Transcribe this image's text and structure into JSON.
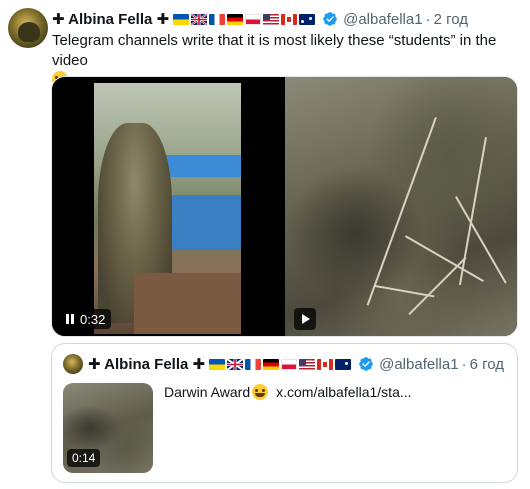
{
  "tweet": {
    "author_name": "✚ Albina Fella ✚",
    "handle": "@albafella1",
    "time": "2 год",
    "text": "Telegram channels write that it is most likely these “students” in the video",
    "emoji_icon": "grinning-face-emoji",
    "flags": [
      "ua",
      "gb",
      "fr",
      "de",
      "pl",
      "us",
      "ca",
      "au"
    ],
    "media": [
      {
        "type": "video",
        "duration": "0:32",
        "state": "playing"
      },
      {
        "type": "video",
        "state": "paused"
      }
    ]
  },
  "quoted_tweet": {
    "author_name": "✚ Albina Fella ✚",
    "handle": "@albafella1",
    "time": "6 год",
    "text": "Darwin Award",
    "link": "x.com/albafella1/sta...",
    "thumb_duration": "0:14",
    "flags": [
      "ua",
      "gb",
      "fr",
      "de",
      "pl",
      "us",
      "ca",
      "au"
    ]
  },
  "colors": {
    "verified": "#1d9bf0",
    "muted": "#536471",
    "border": "#cfd9de"
  }
}
